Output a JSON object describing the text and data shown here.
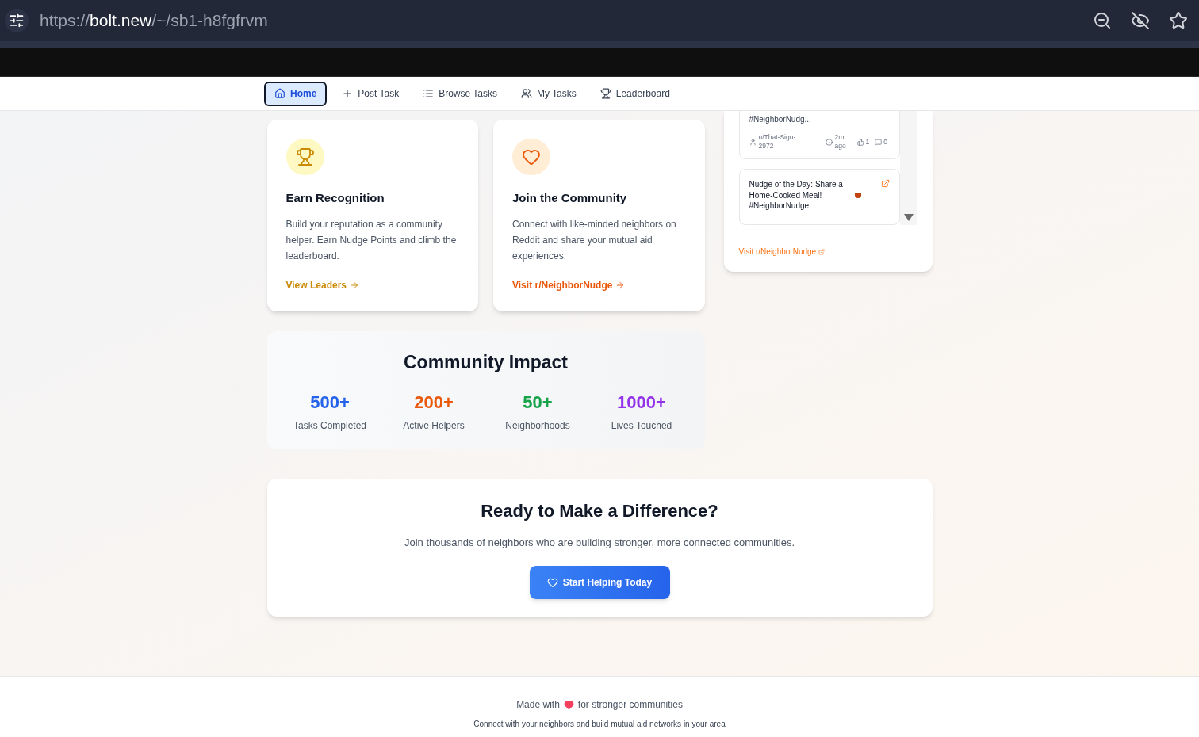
{
  "browser": {
    "url_scheme": "https://",
    "url_host": "bolt.new",
    "url_path": "/~/sb1-h8fgfrvm"
  },
  "nav": [
    {
      "kind": "home",
      "label": "Home",
      "selected": true
    },
    {
      "kind": "plus",
      "label": "Post Task",
      "selected": false
    },
    {
      "kind": "list",
      "label": "Browse Tasks",
      "selected": false
    },
    {
      "kind": "users",
      "label": "My Tasks",
      "selected": false
    },
    {
      "kind": "trophy",
      "label": "Leaderboard",
      "selected": false
    }
  ],
  "feature_cards": [
    {
      "kind": "trophy",
      "title": "Earn Recognition",
      "text": "Build your reputation as a community helper. Earn Nudge Points and climb the leaderboard.",
      "link": "View Leaders"
    },
    {
      "kind": "heart",
      "title": "Join the Community",
      "text": "Connect with like-minded neighbors on Reddit and share your mutual aid experiences.",
      "link": "Visit r/NeighborNudge"
    }
  ],
  "reddit_panel": {
    "posts": [
      {
        "title": "#NeighborNudg...",
        "author": "u/That-Sign-2972",
        "time": "2m ago",
        "votes": "1",
        "comments": "0"
      },
      {
        "title": "Nudge of the Day: Share a Home-Cooked Meal!",
        "hashtag": "#NeighborNudge"
      }
    ],
    "link": "Visit r/NeighborNudge"
  },
  "impact": {
    "title": "Community Impact",
    "stats": [
      {
        "value": "500+",
        "label": "Tasks Completed",
        "color": "#2563eb"
      },
      {
        "value": "200+",
        "label": "Active Helpers",
        "color": "#ea580c"
      },
      {
        "value": "50+",
        "label": "Neighborhoods",
        "color": "#16a34a"
      },
      {
        "value": "1000+",
        "label": "Lives Touched",
        "color": "#9333ea"
      }
    ]
  },
  "cta": {
    "title": "Ready to Make a Difference?",
    "text": "Join thousands of neighbors who are building stronger, more connected communities.",
    "button": "Start Helping Today"
  },
  "footer": {
    "made_with": "Made with",
    "made_for": "for stronger communities",
    "tagline": "Connect with your neighbors and build mutual aid networks in your area"
  }
}
